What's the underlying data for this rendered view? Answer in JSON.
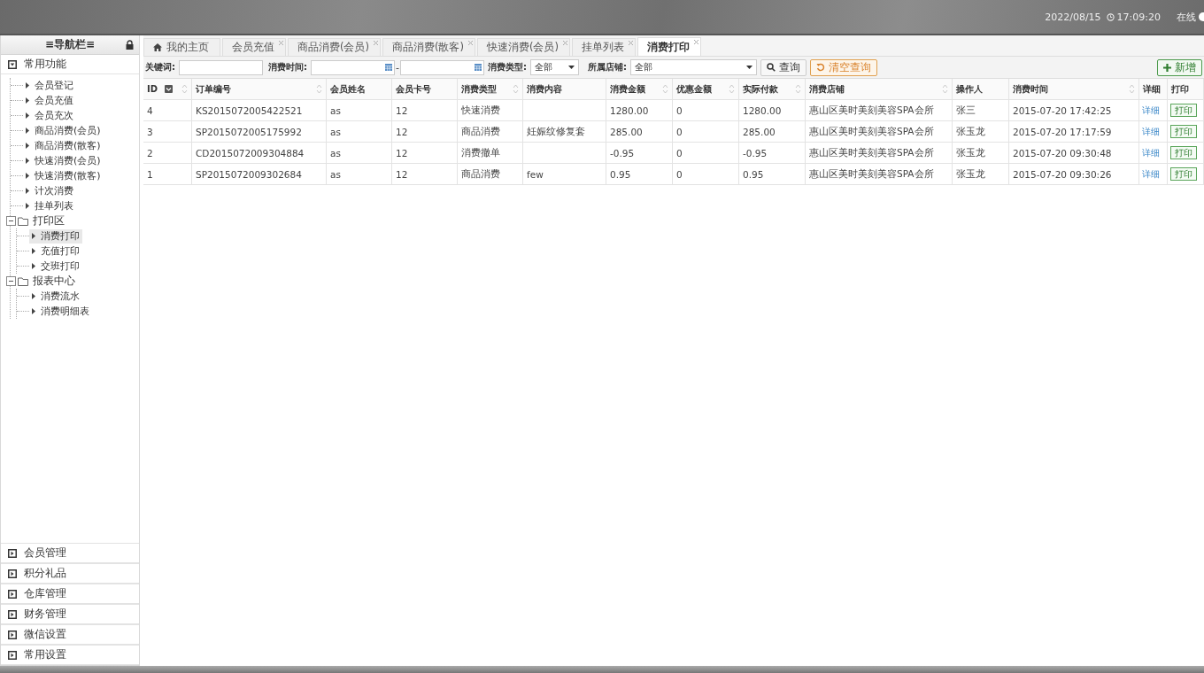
{
  "header": {
    "date": "2022/08/15",
    "time": "17:09:20",
    "status": "在线"
  },
  "sidebar": {
    "title": "≡导航栏≡",
    "sections": [
      {
        "label": "常用功能",
        "expanded": true,
        "items": [
          {
            "kind": "leaf",
            "label": "会员登记",
            "selected": false
          },
          {
            "kind": "leaf",
            "label": "会员充值",
            "selected": false
          },
          {
            "kind": "leaf",
            "label": "会员充次",
            "selected": false
          },
          {
            "kind": "leaf",
            "label": "商品消费(会员)",
            "selected": false
          },
          {
            "kind": "leaf",
            "label": "商品消费(散客)",
            "selected": false
          },
          {
            "kind": "leaf",
            "label": "快速消费(会员)",
            "selected": false
          },
          {
            "kind": "leaf",
            "label": "快速消费(散客)",
            "selected": false
          },
          {
            "kind": "leaf",
            "label": "计次消费",
            "selected": false
          },
          {
            "kind": "leaf",
            "label": "挂单列表",
            "selected": false
          },
          {
            "kind": "folder",
            "label": "打印区",
            "expanded": true,
            "selected": false,
            "children": [
              {
                "kind": "leaf",
                "label": "消费打印",
                "selected": true
              },
              {
                "kind": "leaf",
                "label": "充值打印",
                "selected": false
              },
              {
                "kind": "leaf",
                "label": "交班打印",
                "selected": false
              }
            ]
          },
          {
            "kind": "folder",
            "label": "报表中心",
            "expanded": true,
            "selected": false,
            "children": [
              {
                "kind": "leaf",
                "label": "消费流水",
                "selected": false
              },
              {
                "kind": "leaf",
                "label": "消费明细表",
                "selected": false
              }
            ]
          }
        ]
      },
      {
        "label": "会员管理",
        "expanded": false
      },
      {
        "label": "积分礼品",
        "expanded": false
      },
      {
        "label": "仓库管理",
        "expanded": false
      },
      {
        "label": "财务管理",
        "expanded": false
      },
      {
        "label": "微信设置",
        "expanded": false
      },
      {
        "label": "常用设置",
        "expanded": false
      }
    ]
  },
  "tabs": [
    {
      "label": "我的主页",
      "kind": "home",
      "closable": false,
      "selected": false
    },
    {
      "label": "会员充值",
      "kind": "page",
      "closable": true,
      "selected": false
    },
    {
      "label": "商品消费(会员)",
      "kind": "page",
      "closable": true,
      "selected": false
    },
    {
      "label": "商品消费(散客)",
      "kind": "page",
      "closable": true,
      "selected": false
    },
    {
      "label": "快速消费(会员)",
      "kind": "page",
      "closable": true,
      "selected": false
    },
    {
      "label": "挂单列表",
      "kind": "page",
      "closable": true,
      "selected": false
    },
    {
      "label": "消费打印",
      "kind": "page",
      "closable": true,
      "selected": true
    }
  ],
  "filters": {
    "keyword_label": "关键词:",
    "time_label": "消费时间:",
    "time_separator": "-",
    "type_label": "消费类型:",
    "type_value": "全部",
    "shop_label": "所属店铺:",
    "shop_value": "全部",
    "search_button": "查询",
    "clear_button": "清空查询",
    "add_button": "新增"
  },
  "table": {
    "columns": [
      {
        "label": "ID",
        "sortable": true
      },
      {
        "label": "订单编号",
        "sortable": true
      },
      {
        "label": "会员姓名",
        "sortable": false
      },
      {
        "label": "会员卡号",
        "sortable": false
      },
      {
        "label": "消费类型",
        "sortable": true
      },
      {
        "label": "消费内容",
        "sortable": false
      },
      {
        "label": "消费金额",
        "sortable": true
      },
      {
        "label": "优惠金额",
        "sortable": true
      },
      {
        "label": "实际付款",
        "sortable": true
      },
      {
        "label": "消费店铺",
        "sortable": true
      },
      {
        "label": "操作人",
        "sortable": false
      },
      {
        "label": "消费时间",
        "sortable": true
      },
      {
        "label": "详细",
        "sortable": false
      },
      {
        "label": "打印",
        "sortable": false
      }
    ],
    "rows": [
      {
        "cells": [
          "4",
          "KS2015072005422521",
          "as",
          "12",
          "快速消费",
          "",
          "1280.00",
          "0",
          "1280.00",
          "惠山区美时美刻美容SPA会所",
          "张三",
          "2015-07-20 17:42:25"
        ],
        "detail": "详细",
        "print": "打印"
      },
      {
        "cells": [
          "3",
          "SP2015072005175992",
          "as",
          "12",
          "商品消费",
          "妊娠纹修复套",
          "285.00",
          "0",
          "285.00",
          "惠山区美时美刻美容SPA会所",
          "张玉龙",
          "2015-07-20 17:17:59"
        ],
        "detail": "详细",
        "print": "打印"
      },
      {
        "cells": [
          "2",
          "CD2015072009304884",
          "as",
          "12",
          "消费撤单",
          "",
          "-0.95",
          "0",
          "-0.95",
          "惠山区美时美刻美容SPA会所",
          "张玉龙",
          "2015-07-20 09:30:48"
        ],
        "detail": "详细",
        "print": "打印"
      },
      {
        "cells": [
          "1",
          "SP2015072009302684",
          "as",
          "12",
          "商品消费",
          "few",
          "0.95",
          "0",
          "0.95",
          "惠山区美时美刻美容SPA会所",
          "张玉龙",
          "2015-07-20 09:30:26"
        ],
        "detail": "详细",
        "print": "打印"
      }
    ]
  }
}
